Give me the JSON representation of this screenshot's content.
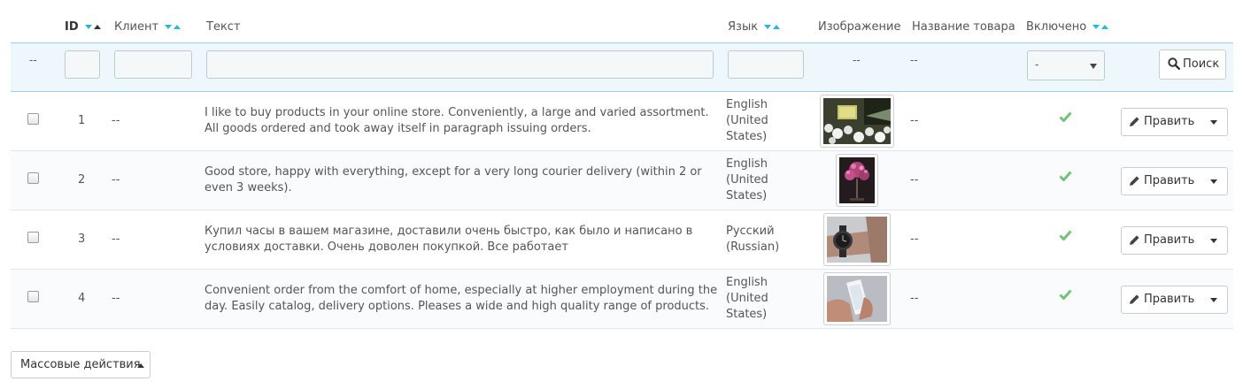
{
  "header": {
    "id": "ID",
    "client": "Клиент",
    "text": "Текст",
    "language": "Язык",
    "image": "Изображение",
    "product_name": "Название товара",
    "enabled": "Включено"
  },
  "filters": {
    "select_dash": "--",
    "image_dash": "--",
    "product_dash": "--",
    "enabled_value": "-",
    "search_label": "Поиск"
  },
  "rows": [
    {
      "id": "1",
      "client": "--",
      "text": "I like to buy products in your online store. Conveniently, a large and varied assortment. All goods ordered and took away itself in paragraph issuing orders.",
      "language": "English (United States)",
      "image": "white-flowers-gift-photo",
      "product_name": "--",
      "enabled": true,
      "edit_label": "Править"
    },
    {
      "id": "2",
      "client": "--",
      "text": "Good store, happy with everything, except for a very long courier delivery (within 2 or even 3 weeks).",
      "language": "English (United States)",
      "image": "pink-tree-lamp-photo",
      "product_name": "--",
      "enabled": true,
      "edit_label": "Править"
    },
    {
      "id": "3",
      "client": "--",
      "text": "Купил часы в вашем магазине, доставили очень быстро, как было и написано в условиях доставки. Очень доволен покупкой. Все работает",
      "language": "Русский (Russian)",
      "image": "wrist-watch-photo",
      "product_name": "--",
      "enabled": true,
      "edit_label": "Править"
    },
    {
      "id": "4",
      "client": "--",
      "text": "Convenient order from the comfort of home, especially at higher employment during the day. Easily catalog, delivery options. Pleases a wide and high quality range of products.",
      "language": "English (United States)",
      "image": "smartphone-in-hand-photo",
      "product_name": "--",
      "enabled": true,
      "edit_label": "Править"
    }
  ],
  "bulk_actions_label": "Массовые действия",
  "colors": {
    "accent": "#25b9d7",
    "check": "#72c279",
    "filter_bg": "#eef7fb"
  }
}
